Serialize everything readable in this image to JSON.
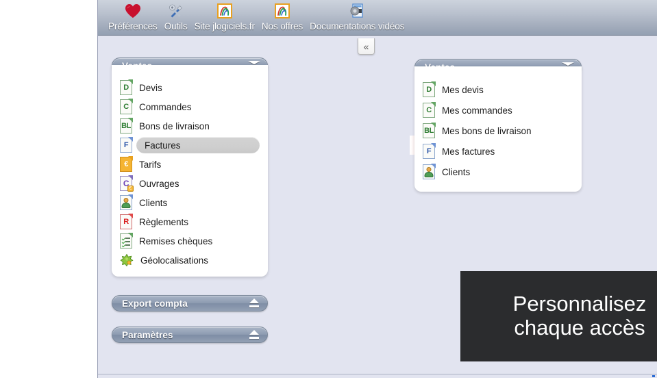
{
  "toolbar": {
    "items": [
      {
        "label": "Préférences",
        "icon": "heart-icon"
      },
      {
        "label": "Outils",
        "icon": "tools-icon"
      },
      {
        "label": "Site jlogiciels.fr",
        "icon": "jlogiciels-logo-icon"
      },
      {
        "label": "Nos offres",
        "icon": "jlogiciels-logo-icon"
      },
      {
        "label": "Documentations vidéos",
        "icon": "video-document-icon"
      }
    ]
  },
  "collapse_button": {
    "label": "«"
  },
  "left_panel": {
    "header": {
      "title": "Ventes",
      "icon": "chevron-double-down-icon"
    },
    "items": [
      {
        "label": "Devis",
        "icon": "document-d-icon",
        "selected": false
      },
      {
        "label": "Commandes",
        "icon": "document-c-icon",
        "selected": false
      },
      {
        "label": "Bons de livraison",
        "icon": "document-bl-icon",
        "selected": false
      },
      {
        "label": "Factures",
        "icon": "document-f-icon",
        "selected": true
      },
      {
        "label": "Tarifs",
        "icon": "document-euro-icon",
        "selected": false
      },
      {
        "label": "Ouvrages",
        "icon": "document-ouvrage-icon",
        "selected": false
      },
      {
        "label": "Clients",
        "icon": "document-person-icon",
        "selected": false
      },
      {
        "label": "Règlements",
        "icon": "document-r-icon",
        "selected": false
      },
      {
        "label": "Remises chèques",
        "icon": "document-checklist-icon",
        "selected": false
      },
      {
        "label": "Géolocalisations",
        "icon": "map-star-icon",
        "selected": false
      }
    ]
  },
  "right_panel": {
    "header": {
      "title": "Ventes",
      "icon": "chevron-double-down-icon"
    },
    "items": [
      {
        "label": "Mes devis",
        "icon": "document-d-icon"
      },
      {
        "label": "Mes commandes",
        "icon": "document-c-icon"
      },
      {
        "label": "Mes bons de livraison",
        "icon": "document-bl-icon"
      },
      {
        "label": "Mes factures",
        "icon": "document-f-icon"
      },
      {
        "label": "Clients",
        "icon": "document-person-icon"
      }
    ]
  },
  "other_panels": [
    {
      "title": "Export compta",
      "icon": "eject-icon"
    },
    {
      "title": "Paramètres",
      "icon": "eject-icon"
    }
  ],
  "arrow": {
    "icon": "right-arrow-icon",
    "color_from": "#ffffff",
    "color_to": "#f50000"
  },
  "caption": {
    "line1": "Personnalisez",
    "line2": "chaque accès",
    "background": "#2b2c2e",
    "text_color": "#ffffff"
  },
  "colors": {
    "app_background": "#e2e4f0",
    "toolbar_top": "#cdd3dd",
    "toolbar_bottom": "#93a0b2",
    "panel_header_mid": "#7e8da5",
    "selection": "#cfcfcf"
  },
  "doc_letters": {
    "d": "D",
    "c": "C",
    "bl": "BL",
    "f": "F",
    "euro": "€",
    "ouvrage": "C",
    "r": "R"
  }
}
